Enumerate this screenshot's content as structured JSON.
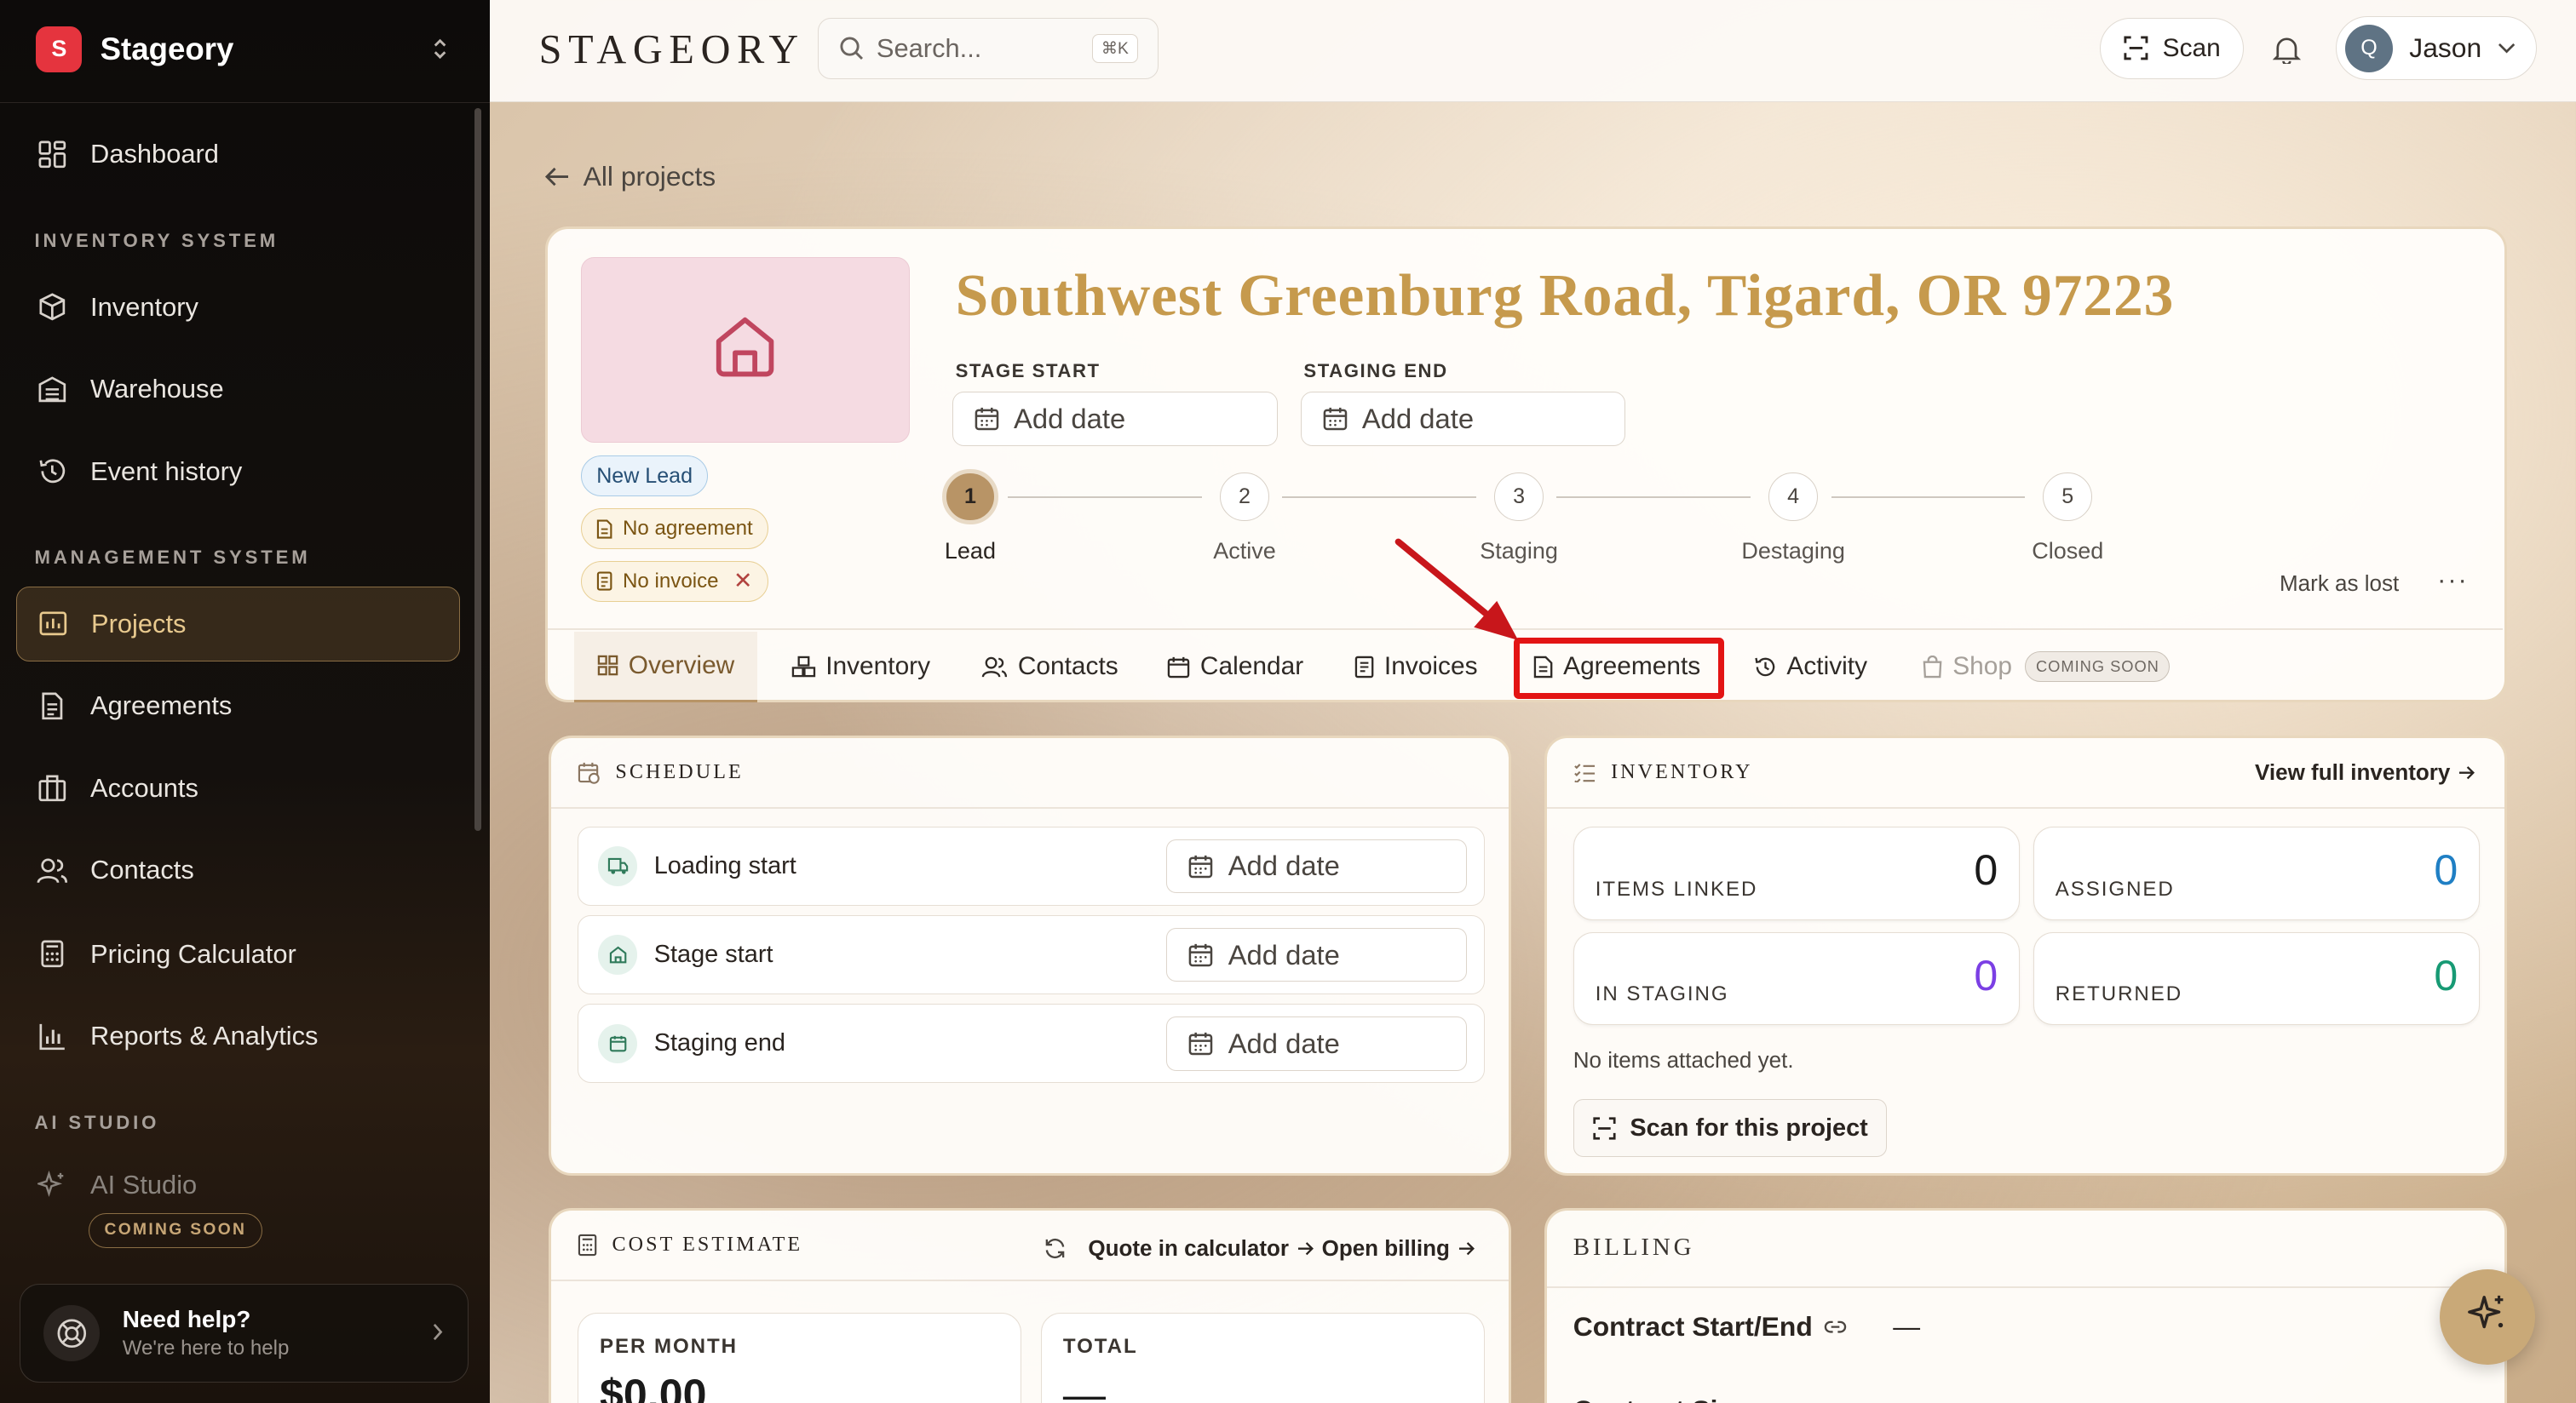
{
  "sidebar": {
    "brand": {
      "logo_letter": "S",
      "name": "Stageory"
    },
    "items": {
      "dashboard": "Dashboard",
      "inventory": "Inventory",
      "warehouse": "Warehouse",
      "event_history": "Event history",
      "projects": "Projects",
      "agreements": "Agreements",
      "accounts": "Accounts",
      "contacts": "Contacts",
      "pricing_calculator": "Pricing Calculator",
      "reports": "Reports & Analytics",
      "ai_studio": "AI Studio"
    },
    "sections": {
      "inventory_system": "INVENTORY SYSTEM",
      "management_system": "MANAGEMENT SYSTEM",
      "ai_studio": "AI STUDIO"
    },
    "ai_coming_soon": "COMING SOON",
    "help": {
      "title": "Need help?",
      "subtitle": "We're here to help"
    },
    "active_item": "Projects",
    "accent_color": "#8a6d44"
  },
  "topbar": {
    "wordmark": "STAGEORY",
    "search_placeholder": "Search...",
    "search_shortcut": "⌘K",
    "scan_label": "Scan",
    "user": {
      "initial": "Q",
      "name": "Jason"
    }
  },
  "back_link": "All projects",
  "project": {
    "title": "Southwest Greenburg Road, Tigard, OR 97223",
    "badges": {
      "status": "New Lead",
      "agreement": "No agreement",
      "invoice": "No invoice"
    },
    "stage_start": {
      "label": "STAGE START",
      "value": "Add date"
    },
    "staging_end": {
      "label": "STAGING END",
      "value": "Add date"
    },
    "steps": [
      {
        "num": "1",
        "label": "Lead"
      },
      {
        "num": "2",
        "label": "Active"
      },
      {
        "num": "3",
        "label": "Staging"
      },
      {
        "num": "4",
        "label": "Destaging"
      },
      {
        "num": "5",
        "label": "Closed"
      }
    ],
    "current_step": 1,
    "mark_lost": "Mark as lost",
    "more": "···",
    "title_color": "#c69a4d"
  },
  "tabs": {
    "overview": "Overview",
    "inventory": "Inventory",
    "contacts": "Contacts",
    "calendar": "Calendar",
    "invoices": "Invoices",
    "agreements": "Agreements",
    "activity": "Activity",
    "shop": "Shop",
    "shop_badge": "COMING SOON",
    "active": "Overview",
    "highlighted": "Agreements",
    "highlight_color": "#e31414"
  },
  "schedule": {
    "title": "SCHEDULE",
    "rows": [
      {
        "label": "Loading start",
        "value": "Add date"
      },
      {
        "label": "Stage start",
        "value": "Add date"
      },
      {
        "label": "Staging end",
        "value": "Add date"
      }
    ]
  },
  "inventory_card": {
    "title": "INVENTORY",
    "view_full": "View full inventory",
    "stats": {
      "items_linked": {
        "label": "ITEMS LINKED",
        "value": "0",
        "color": "#1a1a1a"
      },
      "assigned": {
        "label": "ASSIGNED",
        "value": "0",
        "color": "#1f7fc4"
      },
      "in_staging": {
        "label": "IN STAGING",
        "value": "0",
        "color": "#7b3fe4"
      },
      "returned": {
        "label": "RETURNED",
        "value": "0",
        "color": "#179a74"
      }
    },
    "empty_text": "No items attached yet.",
    "scan_label": "Scan for this project"
  },
  "cost_estimate": {
    "title": "COST ESTIMATE",
    "quote_link": "Quote in calculator",
    "billing_link": "Open billing",
    "per_month": {
      "label": "PER MONTH",
      "value": "$0.00"
    },
    "total": {
      "label": "TOTAL",
      "value": "—"
    }
  },
  "billing": {
    "title": "BILLING",
    "contract_label": "Contract Start/End",
    "contract_value": "—",
    "row2_label": "Contract Si"
  }
}
